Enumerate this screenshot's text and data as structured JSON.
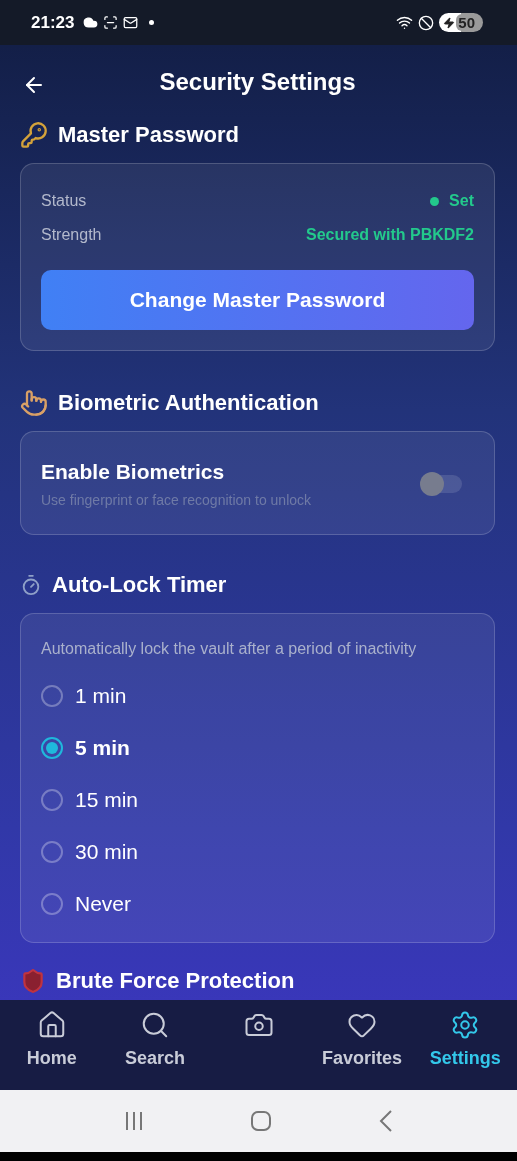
{
  "status_bar": {
    "time": "21:23",
    "battery": "50"
  },
  "header": {
    "title": "Security Settings"
  },
  "master_password": {
    "title": "Master Password",
    "rows": [
      {
        "label": "Status",
        "value": "Set",
        "dot": true
      },
      {
        "label": "Strength",
        "value": "Secured with PBKDF2",
        "dot": false
      }
    ],
    "button": "Change Master Password"
  },
  "biometric": {
    "title": "Biometric Authentication",
    "setting": "Enable Biometrics",
    "description": "Use fingerprint or face recognition to unlock",
    "on": false
  },
  "auto_lock": {
    "title": "Auto-Lock Timer",
    "description": "Automatically lock the vault after a period of inactivity",
    "options": [
      {
        "label": "1 min",
        "selected": false
      },
      {
        "label": "5 min",
        "selected": true
      },
      {
        "label": "15 min",
        "selected": false
      },
      {
        "label": "30 min",
        "selected": false
      },
      {
        "label": "Never",
        "selected": false
      }
    ]
  },
  "brute_force": {
    "title": "Brute Force Protection"
  },
  "bottom_nav": [
    {
      "label": "Home",
      "selected": false
    },
    {
      "label": "Search",
      "selected": false
    },
    {
      "selected": false
    },
    {
      "label": "Favorites",
      "selected": false
    },
    {
      "label": "Settings",
      "selected": true
    }
  ]
}
